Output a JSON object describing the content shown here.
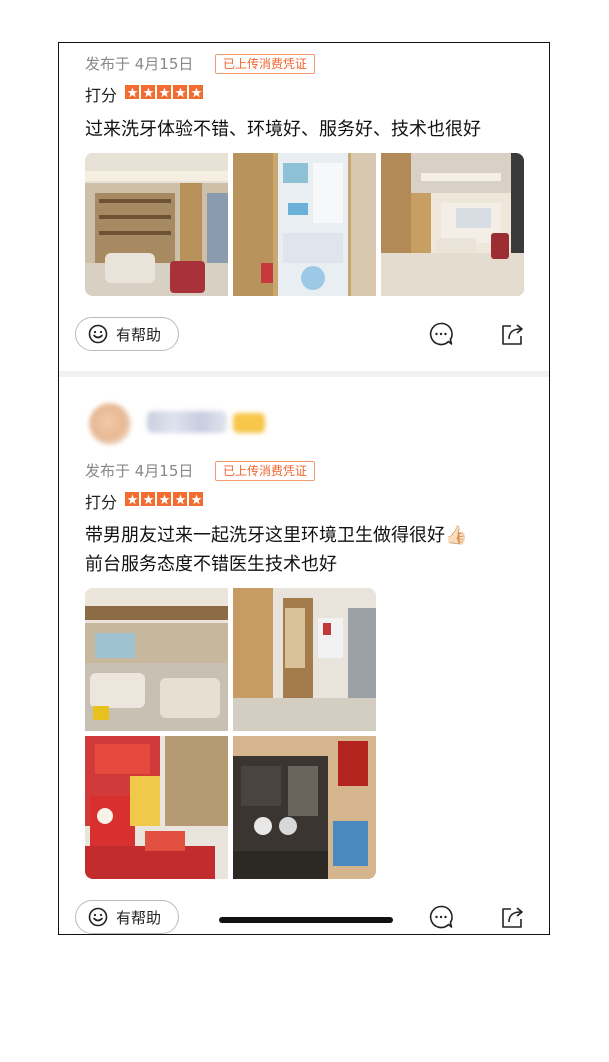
{
  "reviews": [
    {
      "published": "发布于 4月15日",
      "badge": "已上传消费凭证",
      "score_label": "打分",
      "rating": 5,
      "text_lines": [
        "过来洗牙体验不错、环境好、服务好、技术也很好"
      ],
      "photo_count": 3,
      "help_label": "有帮助"
    },
    {
      "published": "发布于 4月15日",
      "badge": "已上传消费凭证",
      "score_label": "打分",
      "rating": 5,
      "text_lines": [
        "带男朋友过来一起洗牙这里环境卫生做得很好👍🏻",
        "前台服务态度不错医生技术也好"
      ],
      "photo_count": 4,
      "help_label": "有帮助"
    }
  ],
  "colors": {
    "accent": "#f26b2f",
    "badge_border": "#f39b6d",
    "meta": "#888888"
  },
  "icons": [
    "smile-icon",
    "comment-icon",
    "share-icon",
    "star-icon"
  ]
}
